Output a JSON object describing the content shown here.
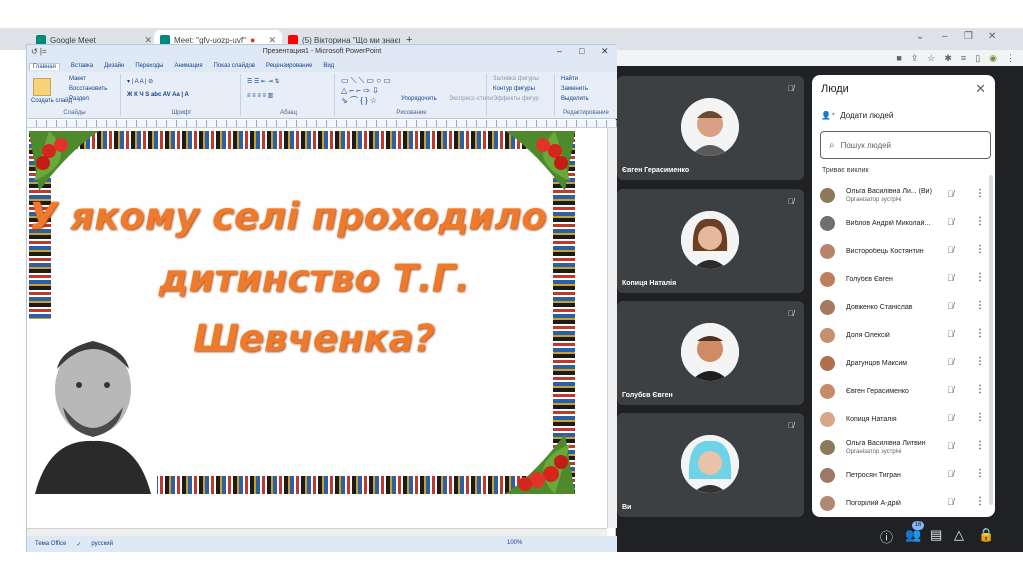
{
  "browser": {
    "tabs": [
      {
        "title": "Google Meet",
        "active": false
      },
      {
        "title": "Meet: \"gfv-uozp-uvf\"",
        "active": true
      },
      {
        "title": "(5) Вікторина \"Що ми знаємо п",
        "active": false
      }
    ],
    "new_tab": "+",
    "toolbar_icons": [
      "camera-icon",
      "share-icon",
      "star-icon",
      "extensions-icon",
      "media-icon",
      "sidebar-icon",
      "profile-icon",
      "menu-icon"
    ]
  },
  "ppt": {
    "window_title": "Презентация1 - Microsoft PowerPoint",
    "menu_tabs": [
      "Главная",
      "Вставка",
      "Дизайн",
      "Переходы",
      "Анимация",
      "Показ слайдов",
      "Рецензирование",
      "Вид"
    ],
    "ribbon": {
      "slides_group": "Слайды",
      "font_group": "Шрифт",
      "paragraph_group": "Абзац",
      "drawing_group": "Рисование",
      "editing_group": "Редактирование",
      "create_slide": "Создать слайд",
      "layout": "Макет",
      "restore": "Восстановить",
      "section": "Раздел",
      "arrange": "Упорядочить",
      "express_styles": "Экспресс-стили",
      "shape_fill": "Заливка фигуры",
      "shape_outline": "Контур фигуры",
      "shape_effects": "Эффекты фигур",
      "find": "Найти",
      "replace": "Заменить",
      "select": "Выделить"
    },
    "slide": {
      "line1": "У якому селі проходило",
      "line2": "дитинство Т.Г.",
      "line3": "Шевченка?"
    },
    "status": {
      "theme": "Тема Office",
      "language": "русский",
      "zoom": "100%"
    }
  },
  "meet": {
    "tiles": [
      {
        "name": "Євген Герасименко",
        "avatar_color": "#c98a6b"
      },
      {
        "name": "Копиця Наталія",
        "avatar_color": "#d9a88a"
      },
      {
        "name": "Голубєв Євген",
        "avatar_color": "#c07e5c"
      },
      {
        "name": "Ви",
        "avatar_color": "#7fd4e8"
      }
    ],
    "people_panel": {
      "title": "Люди",
      "add_people": "Додати людей",
      "search_placeholder": "Пошук людей",
      "section": "Триває виклик",
      "participants": [
        {
          "name": "Ольга Василівна Ли... (Ви)",
          "role": "Організатор зустрічі",
          "color": "#8a7a5a"
        },
        {
          "name": "Виблов Андрій Миколай...",
          "role": "",
          "color": "#6f6f6f"
        },
        {
          "name": "Висторобець Костянтин",
          "role": "",
          "color": "#b7866a"
        },
        {
          "name": "Голубєв Євген",
          "role": "",
          "color": "#c07e5c"
        },
        {
          "name": "Довженко Станіслав",
          "role": "",
          "color": "#a77a60"
        },
        {
          "name": "Доля Олексій",
          "role": "",
          "color": "#c49070"
        },
        {
          "name": "Драгунцов Максим",
          "role": "",
          "color": "#b07050"
        },
        {
          "name": "Євген Герасименко",
          "role": "",
          "color": "#c98a6b"
        },
        {
          "name": "Копиця Наталія",
          "role": "",
          "color": "#d9a88a"
        },
        {
          "name": "Ольга Василівна Литвин",
          "role": "Організатор зустрічі",
          "color": "#8a7a5a"
        },
        {
          "name": "Петросян Тигран",
          "role": "",
          "color": "#9a7a66"
        },
        {
          "name": "Погорілий А-дрій",
          "role": "",
          "color": "#b08870"
        }
      ]
    },
    "participant_count": "16"
  }
}
